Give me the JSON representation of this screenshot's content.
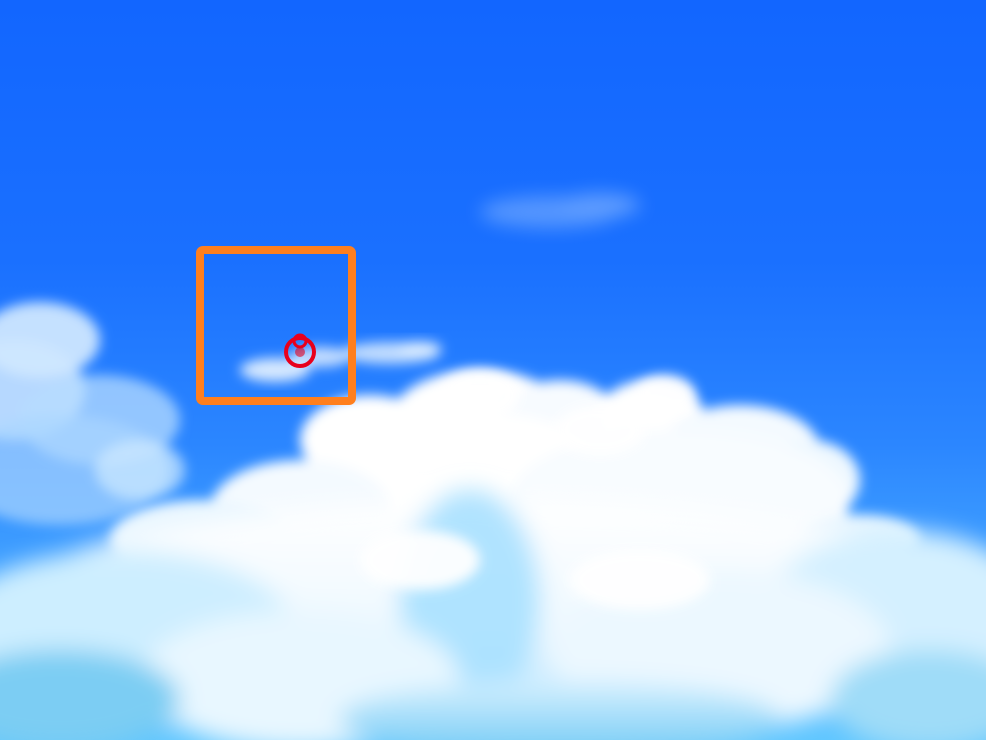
{
  "scene": {
    "description_free": true,
    "elements": {
      "background": "sky",
      "clouds": "cumulus-clouds",
      "annotation_box": "highlight-box",
      "annotation_mark": "target-marker-icon"
    }
  },
  "colors": {
    "sky_top": "#1266ff",
    "sky_mid": "#2b86ff",
    "sky_bottom": "#5fc6ff",
    "cloud_white": "#ffffff",
    "cloud_shadow": "#bfe6ff",
    "cloud_deep": "#7fd0ff",
    "highlight_box": "#ff7f1e",
    "marker": "#e8001c"
  }
}
